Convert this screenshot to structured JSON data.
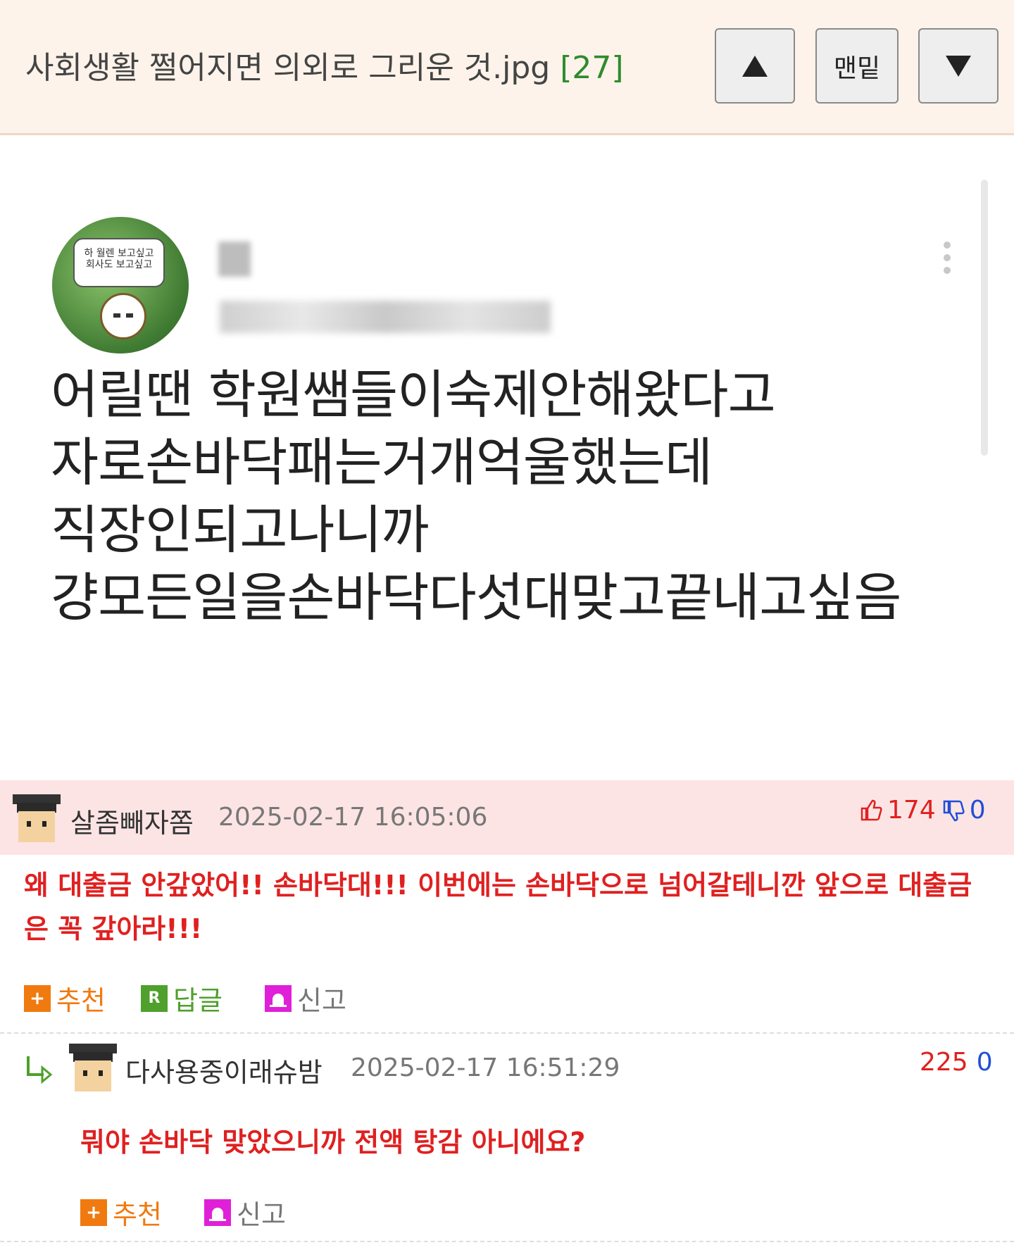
{
  "header": {
    "title": "사회생활 쩔어지면 의외로 그리운 것.jpg",
    "comment_count": "[27]",
    "buttons": {
      "up_icon": "▲",
      "bottom_label": "맨밑",
      "down_icon": "▼"
    }
  },
  "post": {
    "avatar_bubble": "하 월렌 보고싶고 회사도 보고싶고",
    "lines": [
      "어릴땐 학원쌤들이숙제안해왔다고",
      "자로손바닥패는거개억울했는데",
      "직장인되고나니까",
      "걍모든일을손바닥다섯대맞고끝내고싶음"
    ]
  },
  "comments": [
    {
      "username": "살좀빼자쫌",
      "date": "2025-02-17 16:05:06",
      "upvotes": "174",
      "downvotes": "0",
      "text": "왜 대출금 안갚았어!! 손바닥대!!! 이번에는 손바닥으로 넘어갈테니깐 앞으로 대출금은 꼭 갚아라!!!",
      "actions": {
        "recommend": "추천",
        "reply": "답글",
        "report": "신고",
        "reply_icon": "R"
      }
    },
    {
      "username": "다사용중이래슈밤",
      "date": "2025-02-17 16:51:29",
      "upvotes": "225",
      "downvotes": "0",
      "text": "뭐야 손바닥 맞았으니까 전액 탕감 아니에요?",
      "actions": {
        "recommend": "추천",
        "report": "신고"
      }
    }
  ],
  "colors": {
    "accent_red": "#e02020",
    "accent_blue": "#1f4fd8",
    "count_green": "#2e8b2e",
    "header_bg": "#fdf3ea",
    "highlight_bg": "#fde4e4"
  },
  "icons": [
    "up-arrow-icon",
    "down-arrow-icon",
    "thumbs-up-icon",
    "thumbs-down-icon",
    "plus-icon",
    "reply-icon",
    "siren-icon",
    "reply-arrow-icon"
  ]
}
